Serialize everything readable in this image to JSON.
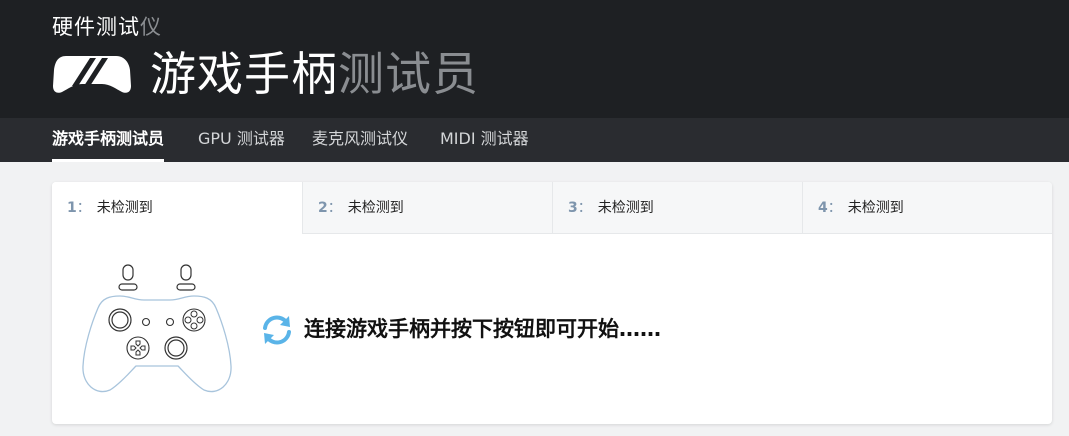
{
  "header": {
    "subtitle_main": "硬件测试",
    "subtitle_dim": "仪",
    "title_main": "游戏手柄",
    "title_dim": "测试员",
    "logo_icon": "gamepad-stripes-logo"
  },
  "nav": {
    "items": [
      {
        "label": "游戏手柄测试员",
        "active": true
      },
      {
        "label": "GPU 测试器",
        "active": false
      },
      {
        "label": "麦克风测试仪",
        "active": false
      },
      {
        "label": "MIDI 测试器",
        "active": false
      }
    ]
  },
  "tabs": [
    {
      "number": "1",
      "separator": "：",
      "status": "未检测到"
    },
    {
      "number": "2",
      "separator": "：",
      "status": "未检测到"
    },
    {
      "number": "3",
      "separator": "：",
      "status": "未检测到"
    },
    {
      "number": "4",
      "separator": "：",
      "status": "未检测到"
    }
  ],
  "panel": {
    "message": "连接游戏手柄并按下按钮即可开始……",
    "gamepad_icon": "gamepad-outline-icon",
    "sync_icon": "sync-arrows-icon"
  },
  "colors": {
    "header_bg": "#1e2023",
    "nav_bg": "#2a2c30",
    "accent_blue": "#5ab4e8",
    "tab_number": "#7e95ad",
    "outline": "#a8c4dc"
  }
}
